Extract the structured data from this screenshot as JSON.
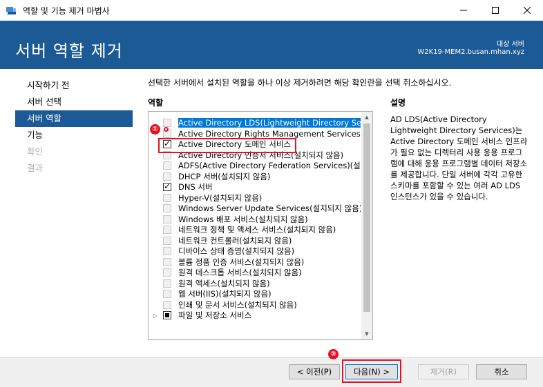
{
  "window": {
    "title": "역할 및 기능 제거 마법사",
    "minimize_glyph": "—",
    "maximize_glyph": "☐",
    "close_glyph": "✕"
  },
  "header": {
    "page_title": "서버 역할 제거",
    "dest_label": "대상 서버",
    "dest_server": "W2K19-MEM2.busan.mhan.xyz",
    "bg_color": "#1c5a96"
  },
  "nav": {
    "items": [
      {
        "label": "시작하기 전",
        "state": "normal"
      },
      {
        "label": "서버 선택",
        "state": "normal"
      },
      {
        "label": "서버 역할",
        "state": "active"
      },
      {
        "label": "기능",
        "state": "normal"
      },
      {
        "label": "확인",
        "state": "disabled"
      },
      {
        "label": "결과",
        "state": "disabled"
      }
    ]
  },
  "main": {
    "instruction": "선택한 서버에서 설치된 역할을 하나 이상 제거하려면 해당 확인란을 선택 취소하십시오.",
    "roles_label": "역할",
    "description_label": "설명",
    "description_text": "AD LDS(Active Directory Lightweight Directory Services)는 Active Directory 도메인 서비스 인프라가 필요 없는 디렉터리 사용 응용 프로그램에 대해 응용 프로그램별 데이터 저장소를 제공합니다. 단일 서버에 각각 고유한 스키마를 포함할 수 있는 여러 AD LDS 인스턴스가 있을 수 있습니다.",
    "roles": [
      {
        "label": "Active Directory LDS(Lightweight Directory Services)",
        "checked": "none",
        "selected": true
      },
      {
        "label": "Active Directory Rights Management Services(설치되지 않음)",
        "checked": "none",
        "selected": false
      },
      {
        "label": "Active Directory 도메인 서비스",
        "checked": "checked",
        "selected": false
      },
      {
        "label": "Active Directory 인증서 서비스(설치되지 않음)",
        "checked": "none",
        "selected": false
      },
      {
        "label": "ADFS(Active Directory Federation Services)(설치되지 않음)",
        "checked": "none",
        "selected": false
      },
      {
        "label": "DHCP 서버(설치되지 않음)",
        "checked": "none",
        "selected": false
      },
      {
        "label": "DNS 서버",
        "checked": "checked",
        "selected": false
      },
      {
        "label": "Hyper-V(설치되지 않음)",
        "checked": "none",
        "selected": false
      },
      {
        "label": "Windows Server Update Services(설치되지 않음)",
        "checked": "none",
        "selected": false
      },
      {
        "label": "Windows 배포 서비스(설치되지 않음)",
        "checked": "none",
        "selected": false
      },
      {
        "label": "네트워크 정책 및 액세스 서비스(설치되지 않음)",
        "checked": "none",
        "selected": false
      },
      {
        "label": "네트워크 컨트롤러(설치되지 않음)",
        "checked": "none",
        "selected": false
      },
      {
        "label": "디바이스 상태 증명(설치되지 않음)",
        "checked": "none",
        "selected": false
      },
      {
        "label": "볼륨 정품 인증 서비스(설치되지 않음)",
        "checked": "none",
        "selected": false
      },
      {
        "label": "원격 데스크톱 서비스(설치되지 않음)",
        "checked": "none",
        "selected": false
      },
      {
        "label": "원격 액세스(설치되지 않음)",
        "checked": "none",
        "selected": false
      },
      {
        "label": "웹 서버(IIS)(설치되지 않음)",
        "checked": "none",
        "selected": false
      },
      {
        "label": "인쇄 및 문서 서비스(설치되지 않음)",
        "checked": "none",
        "selected": false
      },
      {
        "label": "파일 및 저장소 서비스",
        "checked": "partial",
        "selected": false,
        "expandable": true
      }
    ]
  },
  "footer": {
    "prev_label": "< 이전(P)",
    "next_label": "다음(N) >",
    "remove_label": "제거(R)",
    "cancel_label": "취소"
  },
  "annotations": {
    "one": "①",
    "three": "③",
    "color": "#e81123"
  }
}
